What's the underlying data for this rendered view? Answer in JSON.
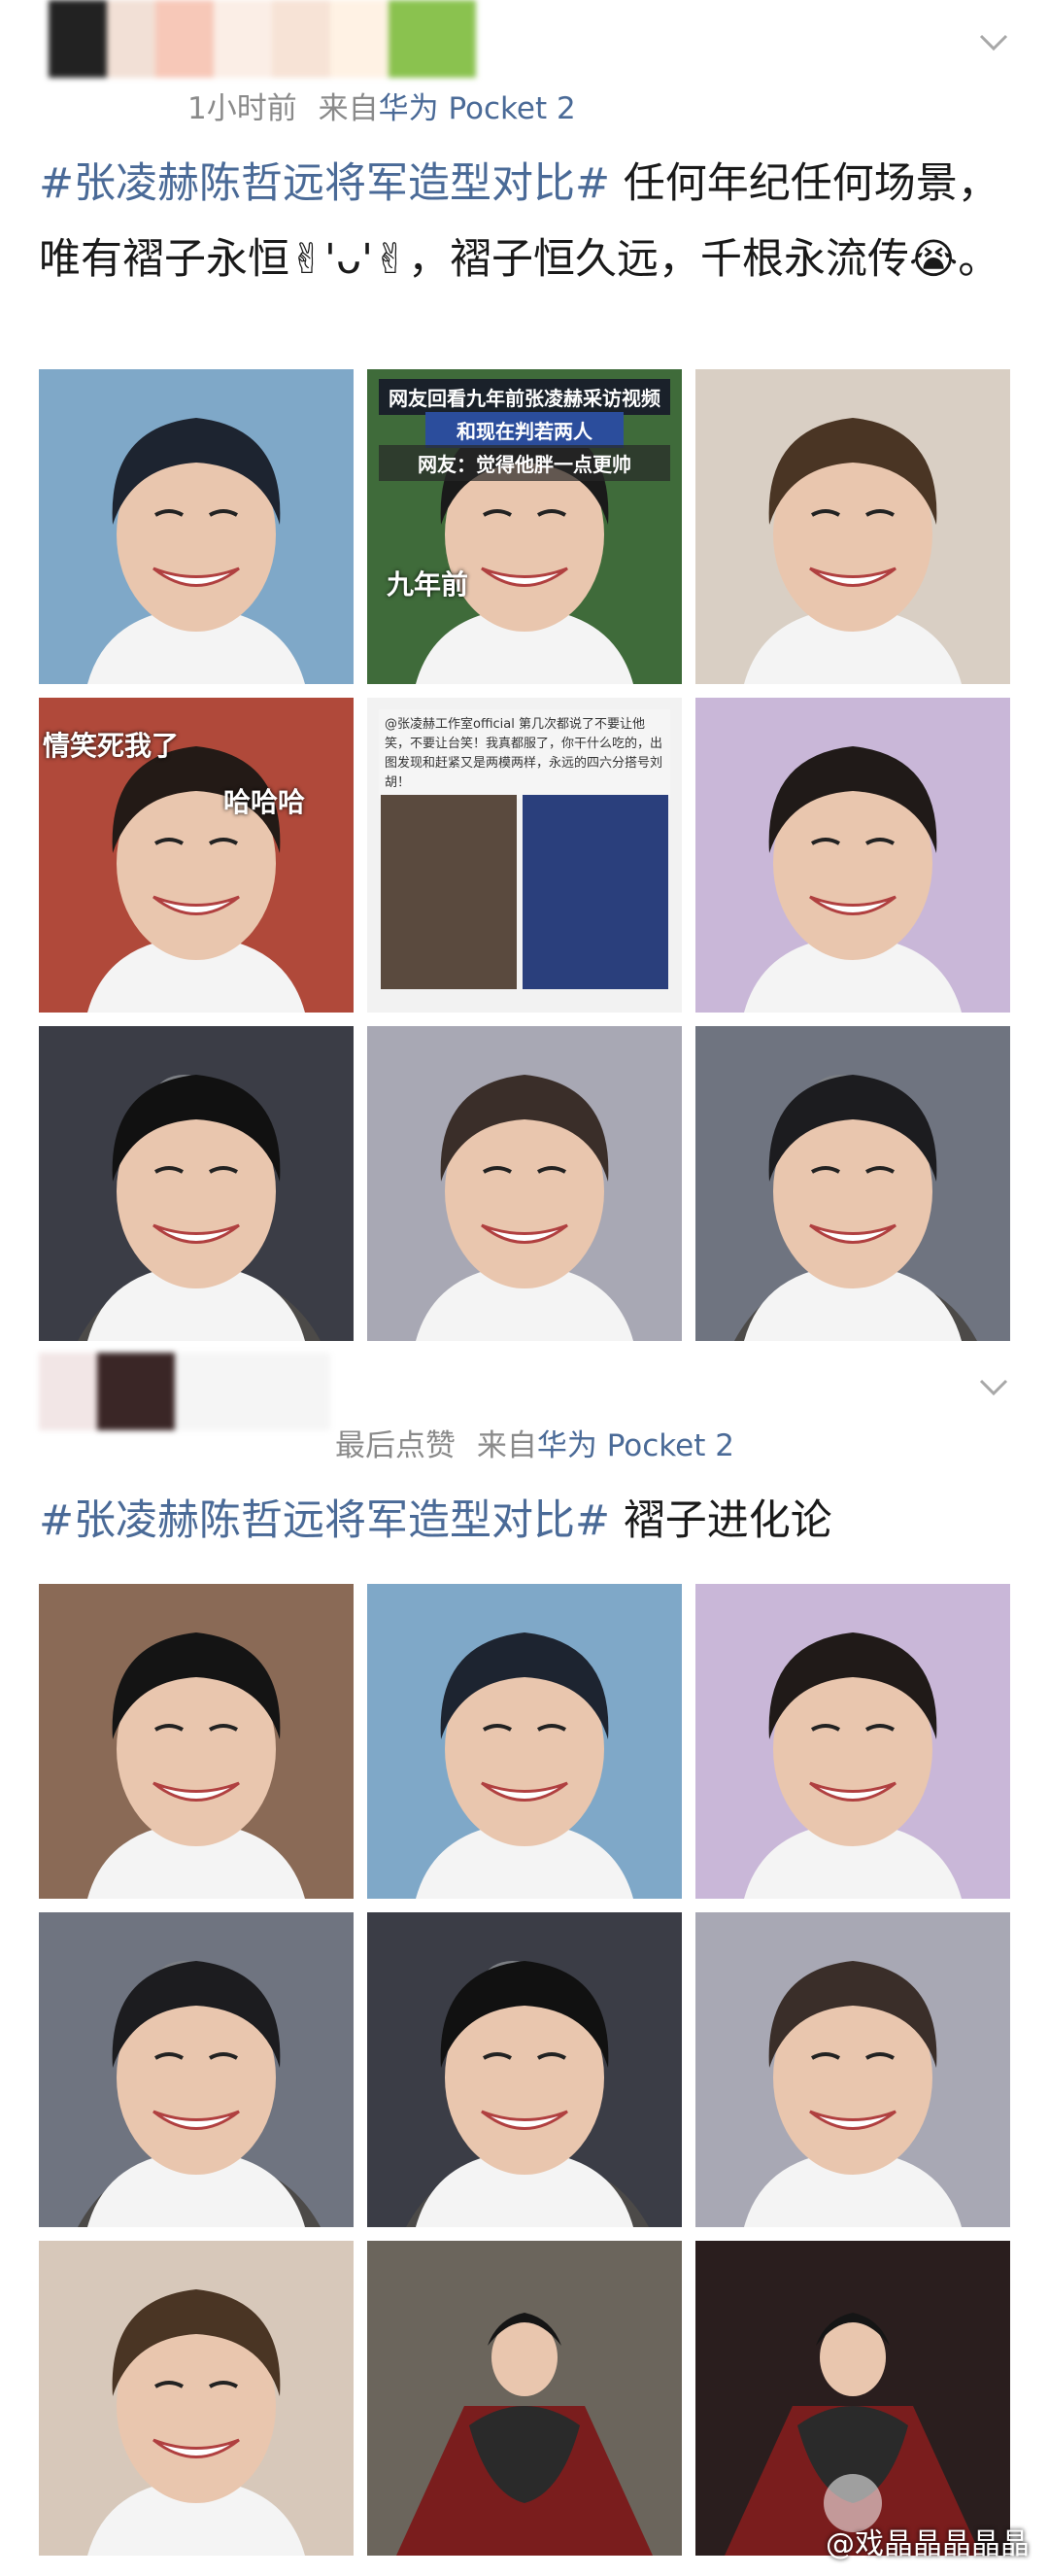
{
  "post1": {
    "time": "1小时前",
    "source_prefix": "来自",
    "source_device": "华为 Pocket 2",
    "hashtag": "#张凌赫陈哲远将军造型对比#",
    "text": " 任何年纪任何场景，唯有褶子永恒✌︎'ᴗ'✌︎，褶子恒久远，千根永流传😭。",
    "images": [
      {
        "kind": "smile",
        "bg": "#7fa8c8",
        "hair": "#1d2430"
      },
      {
        "kind": "video",
        "bg": "#3f6b3a",
        "hair": "#1a1a1a",
        "banner_top": "网友回看九年前张凌赫采访视频",
        "banner_mid": "和现在判若两人",
        "banner_sub": "网友：觉得他胖一点更帅",
        "caption": "九年前"
      },
      {
        "kind": "smile",
        "bg": "#d9cfc4",
        "hair": "#4a3524"
      },
      {
        "kind": "smile",
        "bg": "#b0493a",
        "hair": "#231a16",
        "caption_tl": "情笑死我了",
        "caption_tr": "哈哈哈"
      },
      {
        "kind": "screenshot",
        "bg": "#f2f2f2",
        "hair": "#151515",
        "shot_text": "@张凌赫工作室official 第几次都说了不要让他笑，不要让台笑！我真都服了，你干什么吃的，出图发现和赶紧又是两模两样，永远的四六分搭号刘胡！"
      },
      {
        "kind": "smile",
        "bg": "#c9b7d8",
        "hair": "#201a18"
      },
      {
        "kind": "armor",
        "bg": "#3b3d46",
        "hair": "#111111"
      },
      {
        "kind": "smile",
        "bg": "#a8a8b4",
        "hair": "#3a2e29"
      },
      {
        "kind": "armor",
        "bg": "#6f7480",
        "hair": "#1c1c1f"
      }
    ]
  },
  "post2": {
    "time": "最后点赞",
    "source_prefix": "来自",
    "source_device": "华为 Pocket 2",
    "hashtag": "#张凌赫陈哲远将军造型对比#",
    "text": " 褶子进化论",
    "images": [
      {
        "kind": "glasses",
        "bg": "#8a6a56",
        "hair": "#141414"
      },
      {
        "kind": "smile",
        "bg": "#7fa8c8",
        "hair": "#1d2430"
      },
      {
        "kind": "smile",
        "bg": "#c9b7d8",
        "hair": "#201a18"
      },
      {
        "kind": "armor",
        "bg": "#6f7480",
        "hair": "#1c1c1f"
      },
      {
        "kind": "armor",
        "bg": "#3b3d46",
        "hair": "#111111"
      },
      {
        "kind": "smile",
        "bg": "#a8a8b4",
        "hair": "#3a2e29"
      },
      {
        "kind": "smile",
        "bg": "#d7c8ba",
        "hair": "#4a3524"
      },
      {
        "kind": "cloak",
        "bg": "#6b655c",
        "hair": "#151515"
      },
      {
        "kind": "cloak-video",
        "bg": "#2a1e1e",
        "hair": "#151515"
      }
    ],
    "watermark": "@戏晶晶晶晶晶"
  },
  "colors": {
    "link": "#4a6a97",
    "meta": "#8a8a8a",
    "text": "#1a1a1a"
  }
}
